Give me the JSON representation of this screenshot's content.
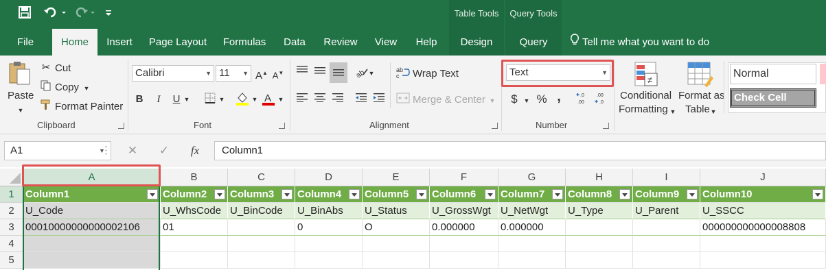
{
  "qat": {
    "save_icon": "save-icon",
    "undo_icon": "undo-icon",
    "redo_icon": "redo-icon",
    "customize_icon": "customize-qat-icon"
  },
  "context_tabs": {
    "table_tools": "Table Tools",
    "query_tools": "Query Tools"
  },
  "tabs": [
    "File",
    "Home",
    "Insert",
    "Page Layout",
    "Formulas",
    "Data",
    "Review",
    "View",
    "Help",
    "Design",
    "Query"
  ],
  "active_tab": "Home",
  "tell_me": "Tell me what you want to do",
  "clipboard": {
    "paste": "Paste",
    "cut": "Cut",
    "copy": "Copy",
    "format_painter": "Format Painter",
    "label": "Clipboard"
  },
  "font": {
    "name": "Calibri",
    "size": "11",
    "label": "Font"
  },
  "alignment": {
    "wrap_text": "Wrap Text",
    "merge_center": "Merge & Center",
    "label": "Alignment"
  },
  "number": {
    "format": "Text",
    "currency_symbol": "$",
    "percent_symbol": "%",
    "comma_symbol": ",",
    "label": "Number"
  },
  "styles": {
    "conditional_formatting_1": "Conditional",
    "conditional_formatting_2": "Formatting",
    "format_as_table_1": "Format as",
    "format_as_table_2": "Table",
    "normal": "Normal",
    "check_cell": "Check Cell"
  },
  "formula_bar": {
    "name_box": "A1",
    "cancel": "✕",
    "enter": "✓",
    "fx": "fx",
    "value": "Column1"
  },
  "grid": {
    "columns": [
      "A",
      "B",
      "C",
      "D",
      "E",
      "F",
      "G",
      "H",
      "I",
      "J"
    ],
    "row_numbers": [
      "1",
      "2",
      "3",
      "4",
      "5"
    ],
    "rows": [
      [
        "Column1",
        "Column2",
        "Column3",
        "Column4",
        "Column5",
        "Column6",
        "Column7",
        "Column8",
        "Column9",
        "Column10"
      ],
      [
        "U_Code",
        "U_WhsCode",
        "U_BinCode",
        "U_BinAbs",
        "U_Status",
        "U_GrossWgt",
        "U_NetWgt",
        "U_Type",
        "U_Parent",
        "U_SSCC"
      ],
      [
        "00010000000000002106",
        "01",
        "",
        "0",
        "O",
        "0.000000",
        "0.000000",
        "",
        "",
        "000000000000008808"
      ],
      [
        "",
        "",
        "",
        "",
        "",
        "",
        "",
        "",
        "",
        ""
      ],
      [
        "",
        "",
        "",
        "",
        "",
        "",
        "",
        "",
        "",
        ""
      ]
    ]
  },
  "colors": {
    "excel_green": "#217346",
    "table_header": "#70ad47",
    "table_band": "#e2efda",
    "highlight": "#e05353"
  }
}
